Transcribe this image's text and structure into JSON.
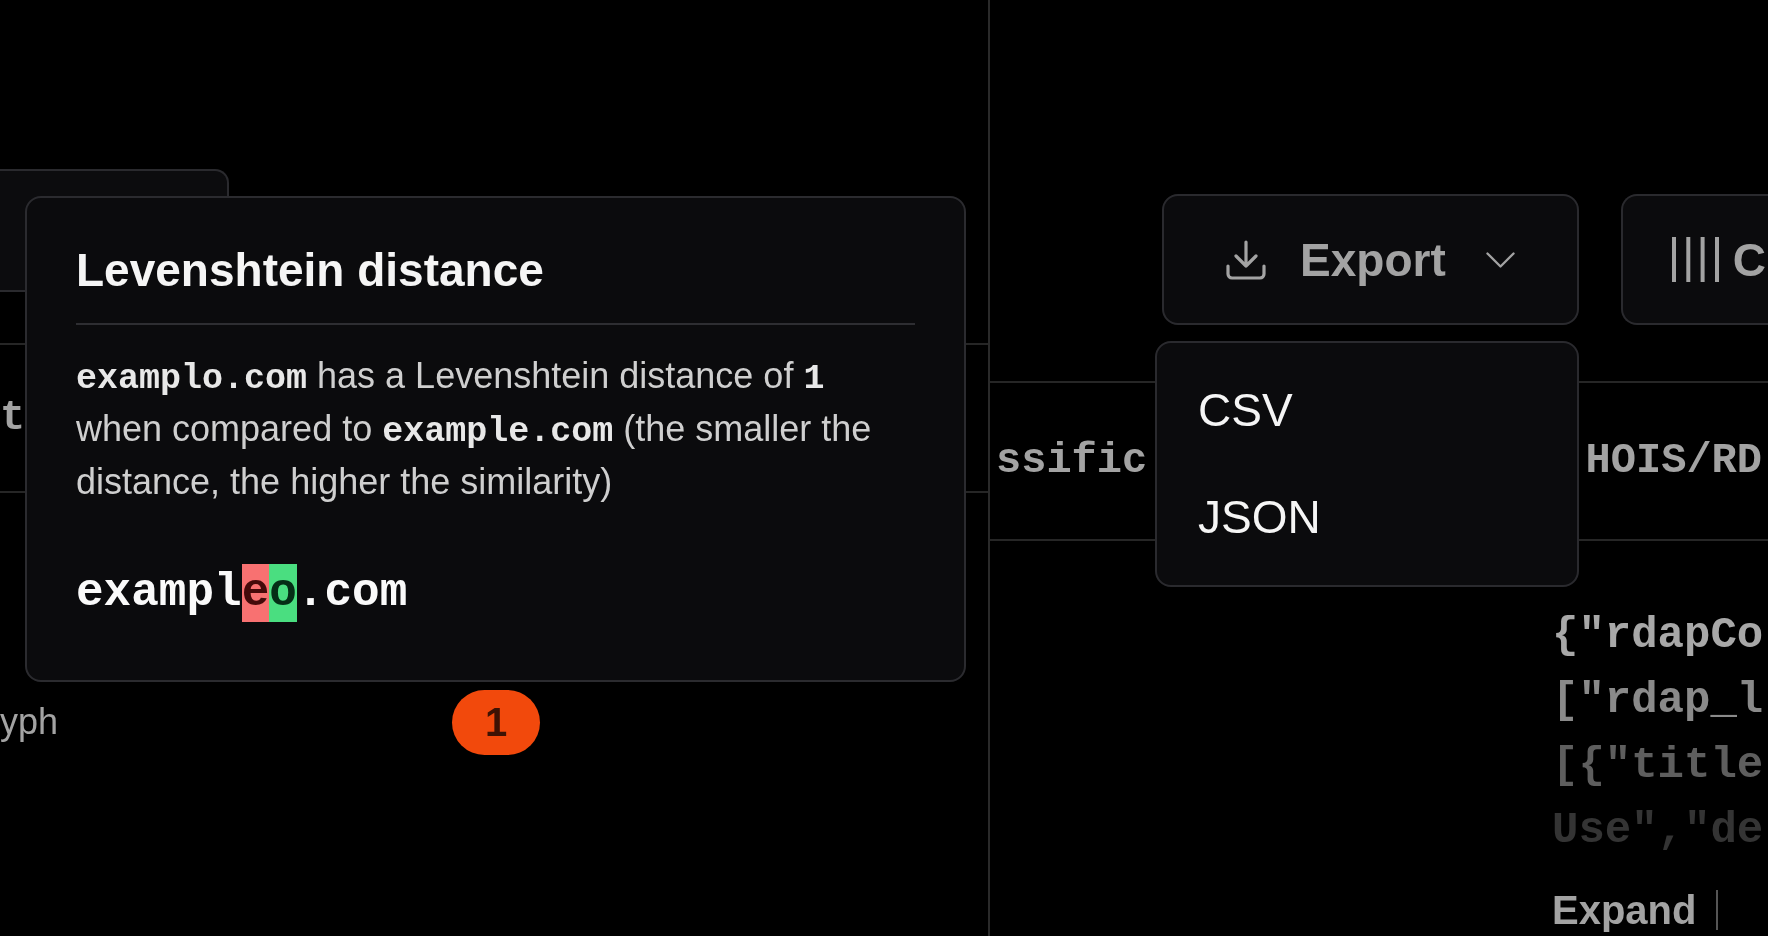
{
  "left_panel": {
    "table_header": {
      "column_1": "t"
    },
    "rows": [
      {
        "cell_1": "yph",
        "badge": "1"
      }
    ]
  },
  "tooltip": {
    "title": "Levenshtein distance",
    "description": "**examplo.com** has a Levenshtein distance of **1** when compared to **example.com** (the smaller the distance, the higher the similarity)",
    "diff": [
      {
        "kind": "same",
        "text": "exampl"
      },
      {
        "kind": "removed",
        "text": "e"
      },
      {
        "kind": "added",
        "text": "o"
      },
      {
        "kind": "same",
        "text": ".com"
      }
    ]
  },
  "right_panel": {
    "buttons": [
      {
        "kind": "export",
        "label": "Export",
        "menu": [
          "CSV",
          "JSON"
        ]
      },
      {
        "kind": "columns",
        "label": "C"
      }
    ],
    "table_header": {
      "column_1": "ssific",
      "column_2": "HOIS/RD"
    },
    "code_preview": [
      "{\"rdapCo",
      "[\"rdap_l",
      "[{\"title",
      "Use\",\"de"
    ],
    "expand_link": "Expand"
  }
}
